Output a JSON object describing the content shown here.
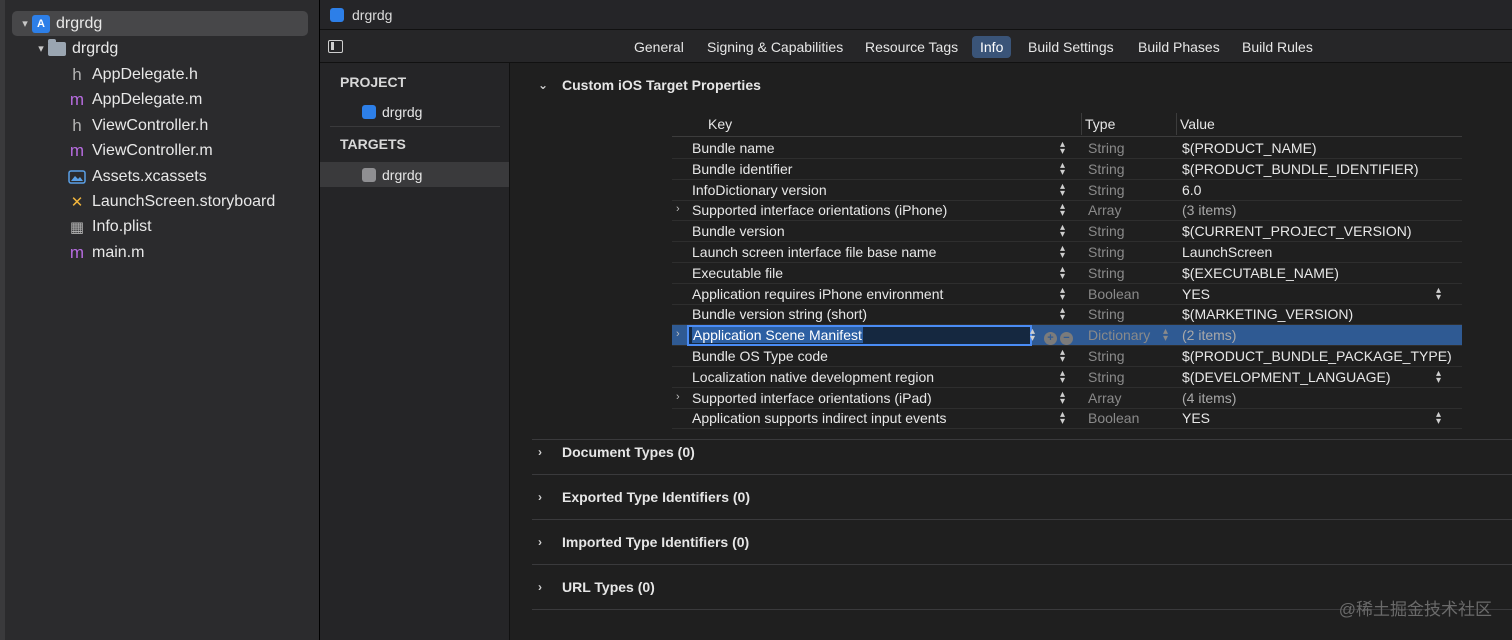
{
  "navigator": {
    "items": [
      {
        "label": "drgrdg",
        "icon": "project-icon",
        "disclosure": "▾"
      },
      {
        "label": "drgrdg",
        "icon": "folder-icon",
        "disclosure": "▾"
      },
      {
        "label": "AppDelegate.h",
        "icon": "header-file-icon",
        "glyph": "h"
      },
      {
        "label": "AppDelegate.m",
        "icon": "objc-file-icon",
        "glyph": "m"
      },
      {
        "label": "ViewController.h",
        "icon": "header-file-icon",
        "glyph": "h"
      },
      {
        "label": "ViewController.m",
        "icon": "objc-file-icon",
        "glyph": "m"
      },
      {
        "label": "Assets.xcassets",
        "icon": "assets-icon",
        "glyph": "🖼"
      },
      {
        "label": "LaunchScreen.storyboard",
        "icon": "storyboard-icon",
        "glyph": "✕"
      },
      {
        "label": "Info.plist",
        "icon": "plist-icon",
        "glyph": "▦"
      },
      {
        "label": "main.m",
        "icon": "objc-file-icon",
        "glyph": "m"
      }
    ]
  },
  "jumpbar": {
    "title": "drgrdg"
  },
  "tabs": [
    "General",
    "Signing & Capabilities",
    "Resource Tags",
    "Info",
    "Build Settings",
    "Build Phases",
    "Build Rules"
  ],
  "active_tab": "Info",
  "target_list": {
    "project_label": "PROJECT",
    "project_name": "drgrdg",
    "targets_label": "TARGETS",
    "target_name": "drgrdg"
  },
  "sections": {
    "custom": "Custom iOS Target Properties",
    "document_types": "Document Types (0)",
    "exported": "Exported Type Identifiers (0)",
    "imported": "Imported Type Identifiers (0)",
    "url_types": "URL Types (0)"
  },
  "plist": {
    "headers": {
      "key": "Key",
      "type": "Type",
      "value": "Value"
    },
    "rows": [
      {
        "key": "Bundle name",
        "type": "String",
        "value": "$(PRODUCT_NAME)"
      },
      {
        "key": "Bundle identifier",
        "type": "String",
        "value": "$(PRODUCT_BUNDLE_IDENTIFIER)"
      },
      {
        "key": "InfoDictionary version",
        "type": "String",
        "value": "6.0"
      },
      {
        "key": "Supported interface orientations (iPhone)",
        "type": "Array",
        "value": "(3 items)"
      },
      {
        "key": "Bundle version",
        "type": "String",
        "value": "$(CURRENT_PROJECT_VERSION)"
      },
      {
        "key": "Launch screen interface file base name",
        "type": "String",
        "value": "LaunchScreen"
      },
      {
        "key": "Executable file",
        "type": "String",
        "value": "$(EXECUTABLE_NAME)"
      },
      {
        "key": "Application requires iPhone environment",
        "type": "Boolean",
        "value": "YES"
      },
      {
        "key": "Bundle version string (short)",
        "type": "String",
        "value": "$(MARKETING_VERSION)"
      },
      {
        "key": "Application Scene Manifest",
        "type": "Dictionary",
        "value": "(2 items)"
      },
      {
        "key": "Bundle OS Type code",
        "type": "String",
        "value": "$(PRODUCT_BUNDLE_PACKAGE_TYPE)"
      },
      {
        "key": "Localization native development region",
        "type": "String",
        "value": "$(DEVELOPMENT_LANGUAGE)"
      },
      {
        "key": "Supported interface orientations (iPad)",
        "type": "Array",
        "value": "(4 items)"
      },
      {
        "key": "Application supports indirect input events",
        "type": "Boolean",
        "value": "YES"
      }
    ]
  },
  "watermark": "@稀土掘金技术社区"
}
